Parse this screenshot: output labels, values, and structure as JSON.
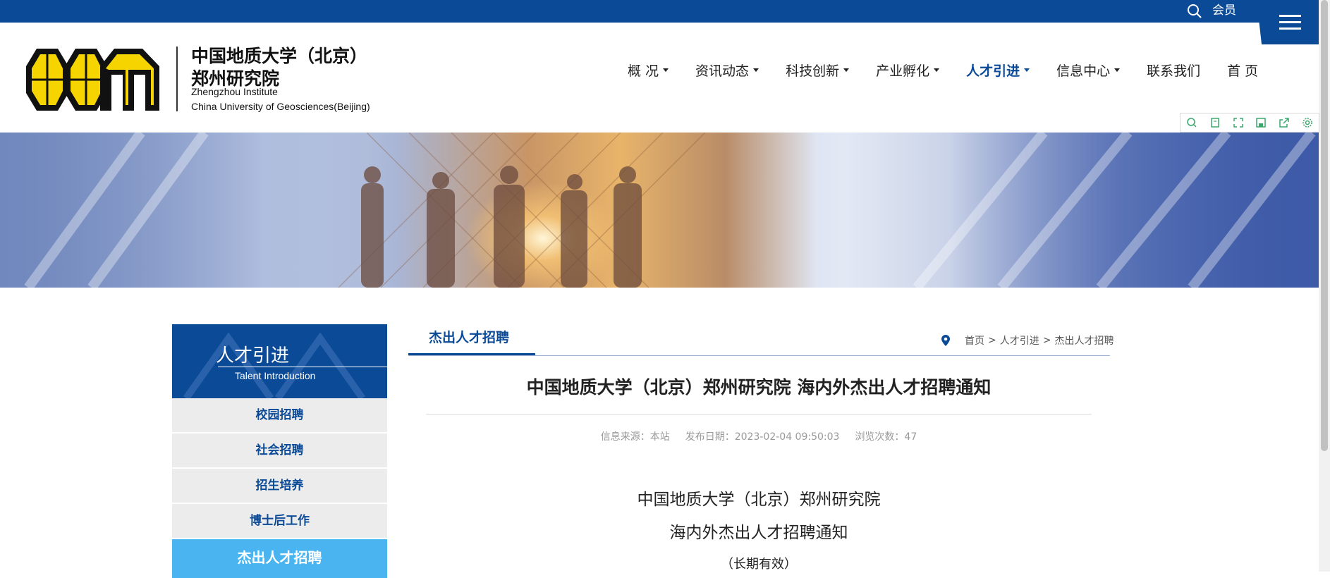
{
  "topbar": {
    "member_label": "会员"
  },
  "header": {
    "org_cn_line1": "中国地质大学（北京）",
    "org_cn_line2": "郑州研究院",
    "org_en_line1": "Zhengzhou Institute",
    "org_en_line2": "China University of Geosciences(Beijing)"
  },
  "nav": {
    "items": [
      {
        "label": "概 况",
        "dropdown": true
      },
      {
        "label": "资讯动态",
        "dropdown": true
      },
      {
        "label": "科技创新",
        "dropdown": true
      },
      {
        "label": "产业孵化",
        "dropdown": true
      },
      {
        "label": "人才引进",
        "dropdown": true,
        "active": true
      },
      {
        "label": "信息中心",
        "dropdown": true
      },
      {
        "label": "联系我们",
        "dropdown": false
      },
      {
        "label": "首 页",
        "dropdown": false
      }
    ]
  },
  "toolbar_icons": [
    "search-icon",
    "bookmark-icon",
    "fullscreen-icon",
    "save-icon",
    "share-icon",
    "settings-icon"
  ],
  "sidebar": {
    "title": "人才引进",
    "subtitle": "Talent Introduction",
    "items": [
      {
        "label": "校园招聘"
      },
      {
        "label": "社会招聘"
      },
      {
        "label": "招生培养"
      },
      {
        "label": "博士后工作"
      },
      {
        "label": "杰出人才招聘",
        "active": true
      }
    ]
  },
  "main": {
    "tab_label": "杰出人才招聘",
    "breadcrumb": [
      "首页",
      "人才引进",
      "杰出人才招聘"
    ],
    "breadcrumb_sep": ">",
    "article_title": "中国地质大学（北京）郑州研究院 海内外杰出人才招聘通知",
    "meta": {
      "source": "信息来源：本站",
      "date": "发布日期：2023-02-04 09:50:03",
      "views": "浏览次数：47"
    },
    "body_line1": "中国地质大学（北京）郑州研究院",
    "body_line2": "海内外杰出人才招聘通知",
    "body_line3": "（长期有效）"
  },
  "colors": {
    "brand_blue": "#0b4a96",
    "active_side": "#4ab4f1",
    "logo_yellow": "#f5d400"
  }
}
